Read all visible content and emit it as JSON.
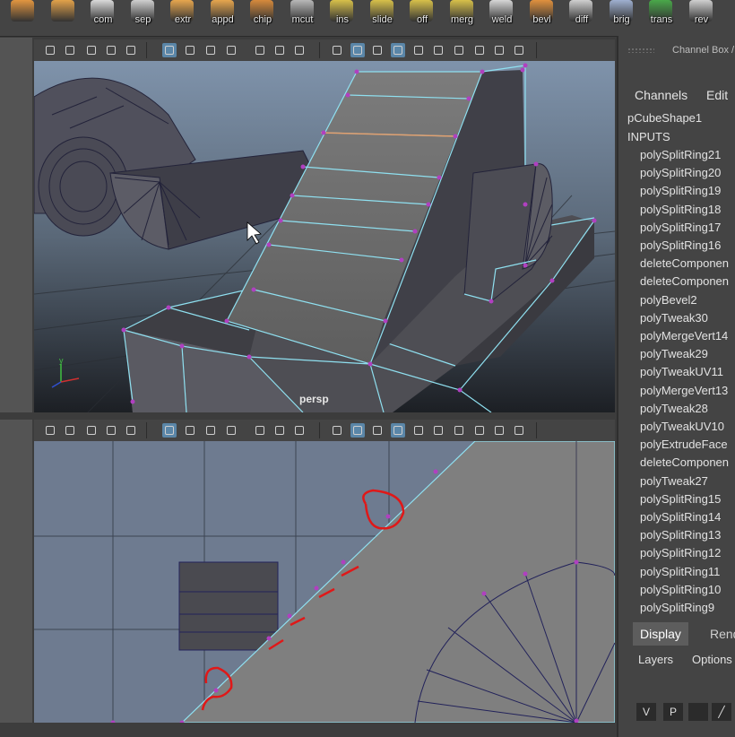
{
  "shelf": {
    "buttons": [
      {
        "label": "",
        "icon": "sphere-icon",
        "color": "#e29640"
      },
      {
        "label": "",
        "icon": "cylinder-icon",
        "color": "#e2a24a"
      },
      {
        "label": "com",
        "icon": "combine-icon",
        "color": "#d9d9d9"
      },
      {
        "label": "sep",
        "icon": "separate-icon",
        "color": "#cfcfcf"
      },
      {
        "label": "extr",
        "icon": "extrude-icon",
        "color": "#e6a64e"
      },
      {
        "label": "appd",
        "icon": "append-icon",
        "color": "#e6a64e"
      },
      {
        "label": "chip",
        "icon": "chip-icon",
        "color": "#d68a3c"
      },
      {
        "label": "mcut",
        "icon": "multicut-icon",
        "color": "#b8b8b8"
      },
      {
        "label": "ins",
        "icon": "insert-loop-icon",
        "color": "#d7c04a"
      },
      {
        "label": "slide",
        "icon": "slide-icon",
        "color": "#d7c04a"
      },
      {
        "label": "off",
        "icon": "offset-icon",
        "color": "#d7c04a"
      },
      {
        "label": "merg",
        "icon": "merge-icon",
        "color": "#d7c04a"
      },
      {
        "label": "weld",
        "icon": "weld-icon",
        "color": "#d6d6d6"
      },
      {
        "label": "bevl",
        "icon": "bevel-icon",
        "color": "#e0913e"
      },
      {
        "label": "diff",
        "icon": "boolean-diff-icon",
        "color": "#cfcfcf"
      },
      {
        "label": "brig",
        "icon": "bridge-icon",
        "color": "#9fb0d0"
      },
      {
        "label": "trans",
        "icon": "transfer-icon",
        "color": "#4aa84a"
      },
      {
        "label": "rev",
        "icon": "reverse-icon",
        "color": "#cfcfcf"
      }
    ]
  },
  "viewport_top": {
    "camera": "persp",
    "toolbar_icons": [
      "camera-icon",
      "camera-lock-icon",
      "bookmark-icon",
      "move-camera-icon",
      "pencil-icon",
      "grid-icon",
      "film-gate-icon",
      "resolution-gate-icon",
      "gate-mask-icon",
      "field-chart-icon",
      "safe-action-icon",
      "safe-title-icon",
      "wireframe-icon",
      "smooth-shade-icon",
      "default-material-icon",
      "wireframe-on-shaded-icon",
      "xray-icon",
      "lighting-icon",
      "shadows-icon",
      "ambient-occlusion-icon",
      "motion-blur-icon",
      "antialias-icon"
    ]
  },
  "viewport_bottom": {
    "toolbar_icons": [
      "camera-icon",
      "camera-lock-icon",
      "bookmark-icon",
      "move-camera-icon",
      "pencil-icon",
      "grid-icon",
      "film-gate-icon",
      "resolution-gate-icon",
      "gate-mask-icon",
      "field-chart-icon",
      "safe-action-icon",
      "safe-title-icon",
      "wireframe-icon",
      "smooth-shade-icon",
      "default-material-icon",
      "wireframe-on-shaded-icon",
      "xray-icon",
      "lighting-icon",
      "shadows-icon",
      "ambient-occlusion-icon",
      "motion-blur-icon",
      "antialias-icon"
    ]
  },
  "channel_box": {
    "title": "Channel Box /",
    "menu": [
      "Channels",
      "Edit"
    ],
    "object": "pCubeShape1",
    "inputs_label": "INPUTS",
    "inputs": [
      "polySplitRing21",
      "polySplitRing20",
      "polySplitRing19",
      "polySplitRing18",
      "polySplitRing17",
      "polySplitRing16",
      "deleteComponen",
      "deleteComponen",
      "polyBevel2",
      "polyTweak30",
      "polyMergeVert14",
      "polyTweak29",
      "polyTweakUV11",
      "polyMergeVert13",
      "polyTweak28",
      "polyTweakUV10",
      "polyExtrudeFace",
      "deleteComponen",
      "polyTweak27",
      "polySplitRing15",
      "polySplitRing14",
      "polySplitRing13",
      "polySplitRing12",
      "polySplitRing11",
      "polySplitRing10",
      "polySplitRing9"
    ]
  },
  "layer_editor": {
    "tabs": [
      "Display",
      "Rend"
    ],
    "menu": [
      "Layers",
      "Options"
    ],
    "buttons": [
      "V",
      "P",
      "",
      ""
    ]
  },
  "colors": {
    "wire_highlight": "#8fe0f0",
    "vertex": "#b040c0",
    "annotation": "#e01818",
    "active_icon": "#5a86a8"
  }
}
